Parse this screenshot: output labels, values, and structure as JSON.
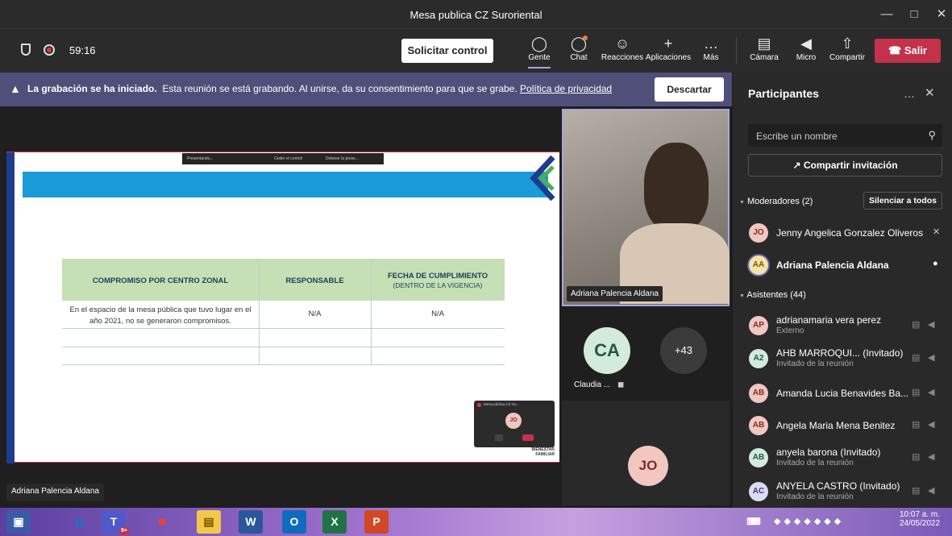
{
  "window": {
    "title": "Mesa publica CZ Suroriental"
  },
  "toolbar": {
    "timer": "59:16",
    "request_control": "Solicitar control",
    "items": [
      {
        "label": "Gente",
        "icon": "people-icon"
      },
      {
        "label": "Chat",
        "icon": "chat-icon"
      },
      {
        "label": "Reacciones",
        "icon": "reactions-icon"
      },
      {
        "label": "Aplicaciones",
        "icon": "apps-icon"
      },
      {
        "label": "Más",
        "icon": "more-icon"
      }
    ],
    "media": [
      {
        "label": "Cámara",
        "icon": "camera-off-icon"
      },
      {
        "label": "Micro",
        "icon": "mic-off-icon"
      },
      {
        "label": "Compartir",
        "icon": "share-icon"
      }
    ],
    "leave": "Salir"
  },
  "banner": {
    "bold": "La grabación se ha iniciado.",
    "text": "Esta reunión se está grabando. Al unirse, da su consentimiento para que se grabe.",
    "link": "Política de privacidad",
    "dismiss": "Descartar"
  },
  "slide": {
    "presenting_bar": {
      "label": "Presentando...",
      "control": "Ceder el control",
      "stop": "Detener la prese..."
    },
    "table": {
      "headers": [
        {
          "main": "COMPROMISO POR CENTRO ZONAL",
          "sub": ""
        },
        {
          "main": "RESPONSABLE",
          "sub": ""
        },
        {
          "main": "FECHA DE CUMPLIMIENTO",
          "sub": "(DENTRO DE LA VIGENCIA)"
        }
      ],
      "rows": [
        [
          "En el espacio de la mesa pública que tuvo lugar en el año 2021, no se generaron compromisos.",
          "N/A",
          "N/A"
        ],
        [
          "",
          "",
          ""
        ],
        [
          "",
          "",
          ""
        ]
      ]
    },
    "mini_window": {
      "title": "Mesa pública CZ Su...",
      "avatar": "JO"
    },
    "footer_brand": "BIENESTAR FAMILIAR"
  },
  "stage": {
    "presenter_name": "Adriana Palencia Aldana",
    "main_video_name": "Adriana Palencia Aldana",
    "tile_ca": {
      "initials": "CA",
      "name": "Claudia ..."
    },
    "tile_more": "+43",
    "tile_jo": "JO"
  },
  "panel": {
    "title": "Participantes",
    "search_placeholder": "Escribe un nombre",
    "share_invite": "Compartir invitación",
    "moderators_label": "Moderadores (2)",
    "mute_all": "Silenciar a todos",
    "attendees_label": "Asistentes (44)",
    "moderators": [
      {
        "initials": "JO",
        "name": "Jenny Angelica Gonzalez Oliveros",
        "sub": "",
        "bold": false
      },
      {
        "initials": "AA",
        "name": "Adriana Palencia Aldana",
        "sub": "",
        "bold": true
      }
    ],
    "attendees": [
      {
        "initials": "AP",
        "name": "adrianamaria vera perez",
        "sub": "Externo"
      },
      {
        "initials": "A2",
        "name": "AHB MARROQUI... (Invitado)",
        "sub": "Invitado de la reunión"
      },
      {
        "initials": "AB",
        "name": "Amanda Lucia Benavides Ba...",
        "sub": ""
      },
      {
        "initials": "AB",
        "name": "Angela Maria Mena Benitez",
        "sub": ""
      },
      {
        "initials": "AB",
        "name": "anyela barona (Invitado)",
        "sub": "Invitado de la reunión"
      },
      {
        "initials": "AC",
        "name": "ANYELA CASTRO (Invitado)",
        "sub": "Invitado de la reunión"
      }
    ]
  },
  "taskbar": {
    "time": "10:07 a. m.",
    "date": "24/05/2022",
    "teams_badge": "9+"
  },
  "colors": {
    "leave": "#c4314b",
    "banner": "#4f4f7a",
    "table_header": "#c5e0b4",
    "slide_band": "#1a9ad6",
    "accent": "#6264a7"
  }
}
